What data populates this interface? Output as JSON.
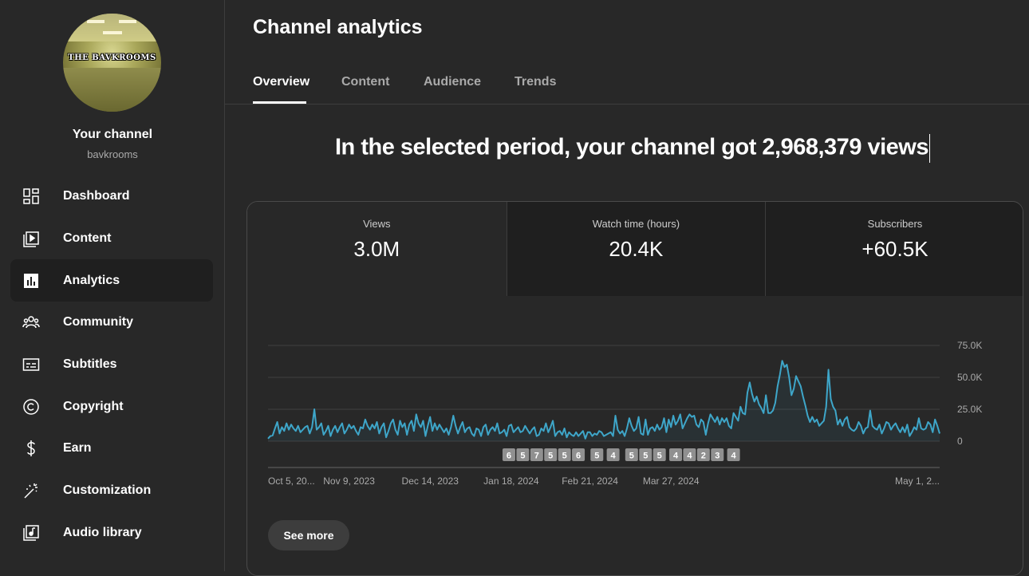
{
  "channel": {
    "name": "Your channel",
    "handle": "bavkrooms",
    "avatar_text": "THE BAVKROOMS"
  },
  "nav": [
    {
      "label": "Dashboard",
      "icon": "dashboard-icon"
    },
    {
      "label": "Content",
      "icon": "content-icon"
    },
    {
      "label": "Analytics",
      "icon": "analytics-icon",
      "active": true
    },
    {
      "label": "Community",
      "icon": "community-icon"
    },
    {
      "label": "Subtitles",
      "icon": "subtitles-icon"
    },
    {
      "label": "Copyright",
      "icon": "copyright-icon"
    },
    {
      "label": "Earn",
      "icon": "earn-icon"
    },
    {
      "label": "Customization",
      "icon": "customization-icon"
    },
    {
      "label": "Audio library",
      "icon": "audio-library-icon"
    }
  ],
  "page": {
    "title": "Channel analytics"
  },
  "tabs": [
    "Overview",
    "Content",
    "Audience",
    "Trends"
  ],
  "headline": "In the selected period, your channel got 2,968,379 views",
  "metrics": [
    {
      "label": "Views",
      "value": "3.0M"
    },
    {
      "label": "Watch time (hours)",
      "value": "20.4K"
    },
    {
      "label": "Subscribers",
      "value": "+60.5K"
    }
  ],
  "see_more_label": "See more",
  "colors": {
    "line": "#3ea6c9",
    "accent": "#ffffff",
    "marker": "#909090"
  },
  "chart_data": {
    "type": "line",
    "series": [
      {
        "name": "Views",
        "values": [
          2000,
          4000,
          4500,
          10000,
          15000,
          6000,
          11000,
          8000,
          14000,
          9000,
          13000,
          10000,
          8000,
          12000,
          7000,
          9000,
          11000,
          12000,
          6000,
          11000,
          25000,
          9000,
          11000,
          14000,
          5000,
          8000,
          12000,
          4000,
          9000,
          12000,
          7000,
          11000,
          14000,
          6000,
          9000,
          13000,
          10000,
          12000,
          8000,
          5000,
          11000,
          10000,
          17000,
          12000,
          9000,
          13000,
          10000,
          15000,
          6000,
          11000,
          14000,
          3000,
          8000,
          14000,
          17000,
          9000,
          5000,
          16000,
          11000,
          14000,
          5000,
          13000,
          16000,
          8000,
          21000,
          14000,
          11000,
          16000,
          4000,
          12000,
          19000,
          8000,
          14000,
          9000,
          13000,
          10000,
          7000,
          10000,
          5000,
          11000,
          20000,
          12000,
          6000,
          11000,
          15000,
          7000,
          10000,
          11000,
          6000,
          4000,
          10000,
          9000,
          4000,
          11000,
          13000,
          5000,
          9000,
          11000,
          8000,
          14000,
          6000,
          7000,
          9000,
          4000,
          12000,
          13000,
          7000,
          9000,
          11000,
          7000,
          8000,
          12000,
          9000,
          6000,
          9000,
          11000,
          4000,
          5000,
          10000,
          8000,
          14000,
          7000,
          11000,
          16000,
          4000,
          7000,
          8000,
          5000,
          10000,
          3000,
          7000,
          5000,
          4000,
          7000,
          4000,
          6000,
          8000,
          2000,
          7000,
          7000,
          4000,
          6000,
          5000,
          8000,
          7000,
          4000,
          5000,
          6000,
          7000,
          4000,
          20000,
          9000,
          6000,
          8000,
          4000,
          10000,
          18000,
          12000,
          8000,
          10000,
          19000,
          6000,
          5000,
          17000,
          5000,
          10000,
          11000,
          8000,
          13000,
          9000,
          11000,
          18000,
          7000,
          17000,
          11000,
          20000,
          13000,
          16000,
          21000,
          10000,
          14000,
          18000,
          21000,
          19000,
          20000,
          13000,
          11000,
          17000,
          15000,
          5000,
          14000,
          21000,
          18000,
          15000,
          19000,
          13000,
          18000,
          15000,
          18000,
          12000,
          10000,
          22000,
          19000,
          16000,
          27000,
          22000,
          21000,
          38000,
          46000,
          37000,
          31000,
          35000,
          29000,
          26000,
          22000,
          36000,
          22000,
          22000,
          24000,
          30000,
          43000,
          52000,
          63000,
          58000,
          60000,
          50000,
          36000,
          41000,
          51000,
          47000,
          43000,
          35000,
          28000,
          20000,
          15000,
          19000,
          15000,
          17000,
          12000,
          14000,
          16000,
          27000,
          56000,
          33000,
          27000,
          24000,
          13000,
          17000,
          12000,
          17000,
          19000,
          11000,
          9000,
          8000,
          10000,
          15000,
          12000,
          6000,
          10000,
          11000,
          24000,
          12000,
          10000,
          9000,
          13000,
          6000,
          10000,
          15000,
          14000,
          9000,
          12000,
          14000,
          10000,
          7000,
          11000,
          7000,
          13000,
          4000,
          7000,
          11000,
          9000,
          18000,
          10000,
          9000,
          10000,
          15000,
          13000,
          7000,
          17000,
          12000,
          6000
        ]
      }
    ],
    "x_tick_labels": [
      "Oct 5, 20...",
      "Nov 9, 2023",
      "Dec 14, 2023",
      "Jan 18, 2024",
      "Feb 21, 2024",
      "Mar 27, 2024",
      "May 1, 2..."
    ],
    "x_tick_positions": [
      0,
      35,
      70,
      105,
      139,
      174,
      209
    ],
    "y_tick_labels": [
      "75.0K",
      "50.0K",
      "25.0K",
      "0"
    ],
    "ylim": [
      0,
      75000
    ],
    "markers": [
      {
        "index": 104,
        "label": "6"
      },
      {
        "index": 110,
        "label": "5"
      },
      {
        "index": 116,
        "label": "7"
      },
      {
        "index": 122,
        "label": "5"
      },
      {
        "index": 128,
        "label": "5"
      },
      {
        "index": 134,
        "label": "6"
      },
      {
        "index": 142,
        "label": "5"
      },
      {
        "index": 149,
        "label": "4"
      },
      {
        "index": 157,
        "label": "5"
      },
      {
        "index": 163,
        "label": "5"
      },
      {
        "index": 169,
        "label": "5"
      },
      {
        "index": 176,
        "label": "4"
      },
      {
        "index": 182,
        "label": "4"
      },
      {
        "index": 188,
        "label": "2"
      },
      {
        "index": 194,
        "label": "3"
      },
      {
        "index": 201,
        "label": "4"
      }
    ],
    "grid": true
  }
}
